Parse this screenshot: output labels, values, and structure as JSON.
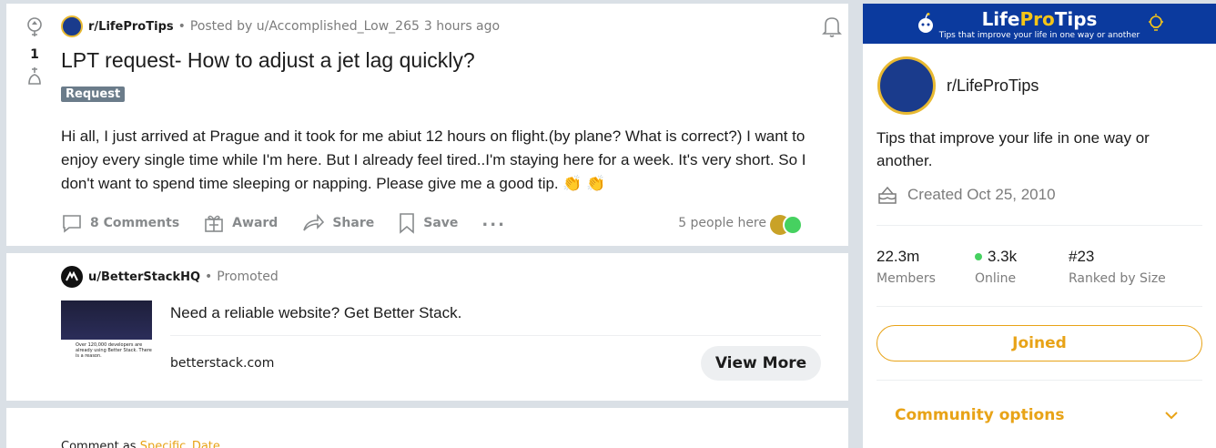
{
  "post": {
    "votes": "1",
    "subreddit": "r/LifeProTips",
    "posted_by": "Posted by u/Accomplished_Low_265",
    "time": "3 hours ago",
    "title": "LPT request- How to adjust a jet lag quickly?",
    "flair": "Request",
    "body": "Hi all, I just arrived at Prague and it took for me abiut 12 hours on flight.(by plane? What is correct?) I want to enjoy every single time while I'm here. But I already feel tired..I'm staying here for a week. It's very short. So I don't want to spend time sleeping or napping. Please give me a good tip. 👏 👏",
    "actions": {
      "comments": "8 Comments",
      "award": "Award",
      "share": "Share",
      "save": "Save",
      "more": "..."
    },
    "people_here": "5 people here"
  },
  "ad": {
    "user": "u/BetterStackHQ",
    "label": "Promoted",
    "headline": "Need a reliable website? Get Better Stack.",
    "domain": "betterstack.com",
    "cta": "View More",
    "thumb_text": "Over 120,000 developers are already using Better Stack. There is a reason."
  },
  "comment": {
    "prefix": "Comment as",
    "user": "Specific_Date"
  },
  "sidebar": {
    "banner_title_a": "Life",
    "banner_title_b": "Pro",
    "banner_title_c": "Tips",
    "banner_subtitle": "Tips that improve your life in one way or another",
    "name": "r/LifeProTips",
    "description": "Tips that improve your life in one way or another.",
    "created": "Created Oct 25, 2010",
    "stats": [
      {
        "value": "22.3m",
        "label": "Members"
      },
      {
        "value": "3.3k",
        "label": "Online"
      },
      {
        "value": "#23",
        "label": "Ranked by Size"
      }
    ],
    "joined_label": "Joined",
    "community_options": "Community options"
  },
  "colors": {
    "accent": "#e8a317",
    "banner": "#0b3a9e",
    "online": "#46d160"
  }
}
